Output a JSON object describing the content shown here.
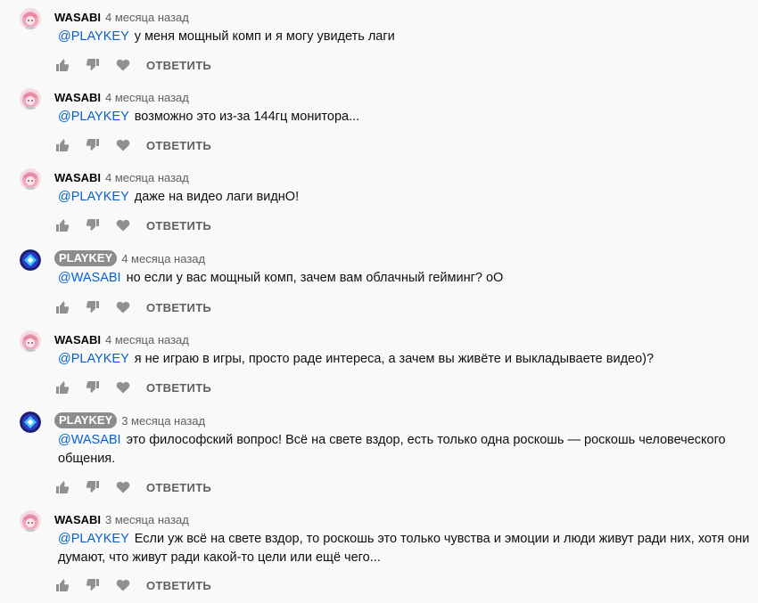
{
  "actions": {
    "reply_label": "ОТВЕТИТЬ"
  },
  "comments": [
    {
      "author": "WASABI",
      "time": "4 месяца назад",
      "mention": "@PLAYKEY",
      "text": "у меня мощный комп и я могу увидеть лаги",
      "channel_owner": false
    },
    {
      "author": "WASABI",
      "time": "4 месяца назад",
      "mention": "@PLAYKEY",
      "text": "возможно это из-за 144гц монитора...",
      "channel_owner": false
    },
    {
      "author": "WASABI",
      "time": "4 месяца назад",
      "mention": "@PLAYKEY",
      "text": "даже на видео лаги виднО!",
      "channel_owner": false
    },
    {
      "author": "PLAYKEY",
      "time": "4 месяца назад",
      "mention": "@WASABI",
      "text": "но если у вас мощный комп, зачем вам облачный гейминг? оО",
      "channel_owner": true
    },
    {
      "author": "WASABI",
      "time": "4 месяца назад",
      "mention": "@PLAYKEY",
      "text": "я не играю в игры, просто раде интереса, а зачем вы живёте и выкладываете видео)?",
      "channel_owner": false
    },
    {
      "author": "PLAYKEY",
      "time": "3 месяца назад",
      "mention": "@WASABI",
      "text": "это философский вопрос! Всё на свете вздор, есть только одна роскошь — роскошь человеческого общения.",
      "channel_owner": true
    },
    {
      "author": "WASABI",
      "time": "3 месяца назад",
      "mention": "@PLAYKEY",
      "text": "Если уж всё на свете вздор, то роскошь это только чувства и эмоции и люди живут ради них, хотя они думают, что живут ради какой-то цели или ещё чего...",
      "channel_owner": false
    }
  ],
  "colors": {
    "background": "#f9f9f9",
    "mention": "#065fd4",
    "secondary_text": "#606060",
    "owner_badge": "#8c8c8c",
    "icon": "#909090"
  },
  "icons": {
    "like": "thumbs-up-icon",
    "dislike": "thumbs-down-icon",
    "heart": "heart-icon",
    "avatar_wasabi": "anime-girl-avatar",
    "avatar_playkey": "playkey-logo-avatar"
  }
}
